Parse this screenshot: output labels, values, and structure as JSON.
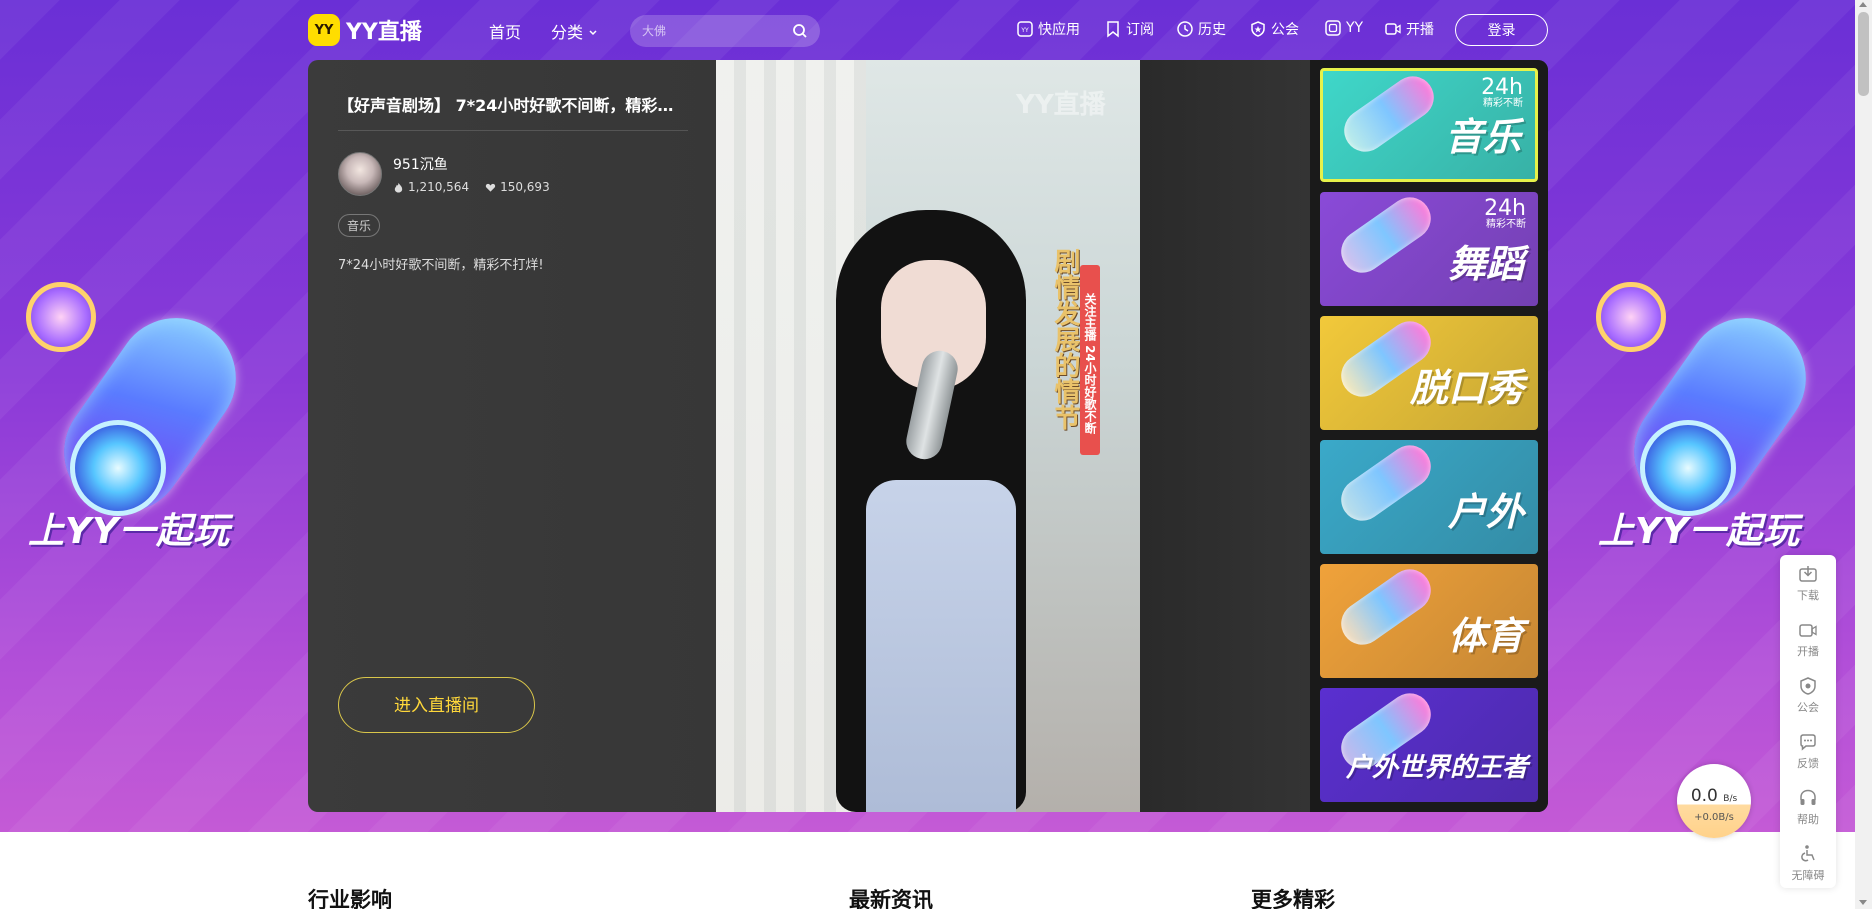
{
  "header": {
    "logo_badge": "YY",
    "logo_text": "YY直播",
    "nav": {
      "home": "首页",
      "category": "分类"
    },
    "search": {
      "placeholder": "大佛"
    },
    "links": {
      "quick_app": "快应用",
      "subscribe": "订阅",
      "history": "历史",
      "guild": "公会",
      "yy": "YY",
      "broadcast": "开播"
    },
    "login": "登录"
  },
  "promo": {
    "slogan": "上YY一起玩"
  },
  "room": {
    "title": "【好声音剧场】 7*24小时好歌不间断，精彩不...",
    "anchor": "951沉鱼",
    "popularity": "1,210,564",
    "likes": "150,693",
    "tag": "音乐",
    "description": "7*24小时好歌不间断，精彩不打烊!",
    "enter_button": "进入直播间"
  },
  "video": {
    "watermark": "YY直播",
    "caption_red": "关注主播 24小时好歌不断",
    "caption_gold": "剧情发展的情节"
  },
  "categories": [
    {
      "label": "音乐",
      "badge_num": "24h",
      "badge_text": "精彩不断",
      "active": true,
      "bg": "#3fd7c9"
    },
    {
      "label": "舞蹈",
      "badge_num": "24h",
      "badge_text": "精彩不断",
      "active": false,
      "bg": "#8a4ad8"
    },
    {
      "label": "脱口秀",
      "badge_num": "",
      "badge_text": "",
      "active": false,
      "bg": "#f2c93a"
    },
    {
      "label": "户外",
      "badge_num": "",
      "badge_text": "",
      "active": false,
      "bg": "#3aa9c9"
    },
    {
      "label": "体育",
      "badge_num": "",
      "badge_text": "",
      "active": false,
      "bg": "#f0a23a"
    },
    {
      "label": "户外世界的王者",
      "badge_num": "",
      "badge_text": "",
      "active": false,
      "bg": "#5a2fd0"
    }
  ],
  "sections": {
    "industry": "行业影响",
    "news": "最新资讯",
    "more": "更多精彩"
  },
  "toolbar": {
    "download": "下载",
    "broadcast": "开播",
    "guild": "公会",
    "feedback": "反馈",
    "help": "帮助",
    "accessibility": "无障碍"
  },
  "speed": {
    "value": "0.0",
    "unit": "B/s",
    "delta": "+0.0B/s"
  },
  "colors": {
    "accent": "#ffd83a",
    "brand": "#6a2fd6",
    "active_border": "#e7f24a"
  }
}
